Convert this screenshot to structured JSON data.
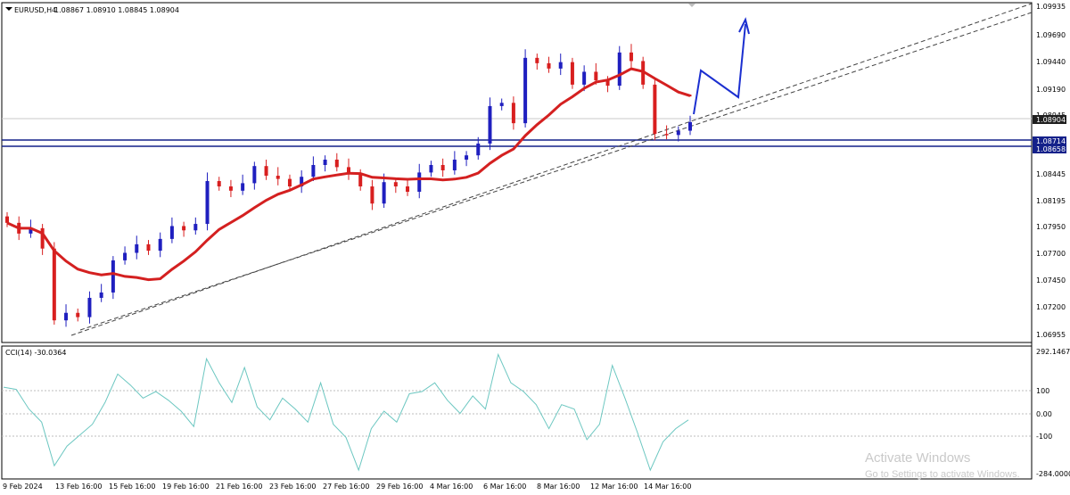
{
  "header": {
    "symbol_label": "EURUSD,H4",
    "ohlc_values": "1.08867 1.08910 1.08845 1.08904"
  },
  "indicator": {
    "label": "CCI(14) -30.0364",
    "axis_labels": [
      "292.1467",
      "100",
      "0.00",
      "-100",
      "-284.0000"
    ]
  },
  "price_axis": {
    "ticks": [
      "1.09935",
      "1.09690",
      "1.09440",
      "1.09190",
      "1.08945",
      "1.08904",
      "1.08714",
      "1.08658",
      "1.08445",
      "1.08195",
      "1.07950",
      "1.07700",
      "1.07450",
      "1.07200",
      "1.06955"
    ]
  },
  "time_axis": {
    "ticks": [
      "9 Feb 2024",
      "13 Feb 16:00",
      "15 Feb 16:00",
      "19 Feb 16:00",
      "21 Feb 16:00",
      "23 Feb 16:00",
      "27 Feb 16:00",
      "29 Feb 16:00",
      "4 Mar 16:00",
      "6 Mar 16:00",
      "8 Mar 16:00",
      "12 Mar 16:00",
      "14 Mar 16:00"
    ]
  },
  "watermark": {
    "title": "Activate Windows",
    "subtitle": "Go to Settings to activate Windows."
  },
  "colors": {
    "bull": "#1f1fbf",
    "bear": "#d81f1f",
    "ma": "#d42020",
    "level": "#14218a",
    "cci": "#6cc7c1",
    "arrow": "#1b2fd0",
    "price_badge": "#1f1f1f",
    "level_badge": "#14218a"
  },
  "chart_data": [
    {
      "type": "candlestick",
      "title": "EURUSD,H4",
      "ylim": [
        1.0686,
        1.0999
      ],
      "price_line": 1.08904,
      "horizontal_levels": [
        1.08714,
        1.08658
      ],
      "moving_average_start_end": [
        1.0796,
        1.0914
      ],
      "trendline_from_to": [
        [
          "13 Feb 16:00",
          1.0693
        ],
        [
          "14 Mar 16:00",
          1.0866
        ]
      ],
      "projection": "upward arrow from ~1.0895 to ~1.0963 with pullback to ~1.0916",
      "closes_approx": [
        1.0796,
        1.0786,
        1.0791,
        1.0772,
        1.0705,
        1.0712,
        1.0708,
        1.0726,
        1.0731,
        1.0761,
        1.0768,
        1.0776,
        1.077,
        1.0781,
        1.0793,
        1.0789,
        1.0795,
        1.0835,
        1.083,
        1.0826,
        1.0833,
        1.0849,
        1.084,
        1.0837,
        1.083,
        1.0839,
        1.085,
        1.0855,
        1.0848,
        1.0842,
        1.083,
        1.0814,
        1.0834,
        1.083,
        1.0825,
        1.0843,
        1.085,
        1.0845,
        1.0855,
        1.0859,
        1.087,
        1.0905,
        1.0908,
        1.0889,
        1.095,
        1.0945,
        1.094,
        1.0946,
        1.0925,
        1.0937,
        1.0929,
        1.0924,
        1.0955,
        1.0947,
        1.0925,
        1.0879,
        1.0878,
        1.0882,
        1.089
      ]
    },
    {
      "type": "line",
      "title": "CCI(14) -30.0364",
      "ylim": [
        -284.0,
        292.1467
      ],
      "levels": [
        100,
        0,
        -100
      ],
      "values_approx": [
        120,
        110,
        20,
        -40,
        -240,
        -150,
        -100,
        -50,
        50,
        180,
        130,
        70,
        100,
        60,
        10,
        -60,
        250,
        140,
        50,
        210,
        30,
        -30,
        70,
        20,
        -40,
        140,
        -50,
        -110,
        -260,
        -70,
        10,
        -40,
        90,
        100,
        140,
        60,
        0,
        80,
        20,
        270,
        140,
        100,
        40,
        -70,
        40,
        20,
        -120,
        -50,
        220,
        70,
        -90,
        -260,
        -130,
        -70,
        -30
      ]
    }
  ]
}
